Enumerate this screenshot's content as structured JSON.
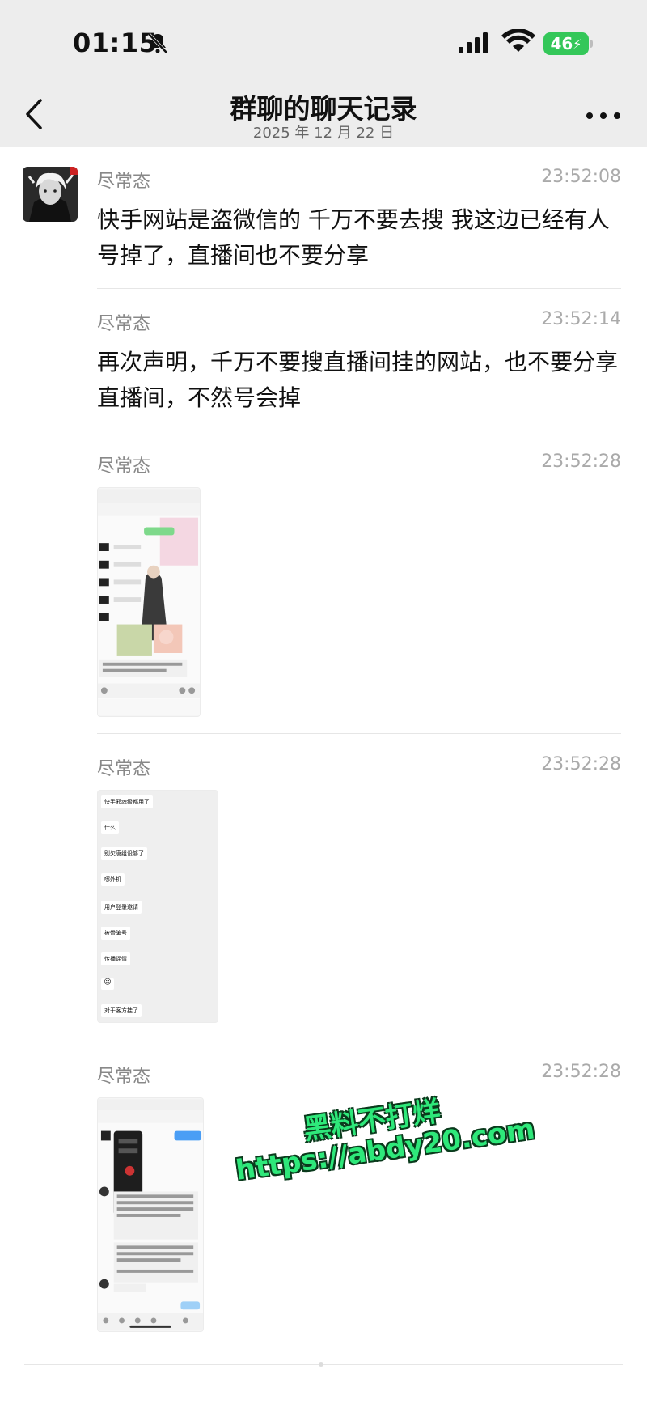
{
  "status_bar": {
    "time": "01:15",
    "battery_level": "46",
    "icons": [
      "bell-muted-icon",
      "cellular-signal-icon",
      "wifi-icon",
      "battery-charging-icon"
    ]
  },
  "nav": {
    "title": "群聊的聊天记录",
    "subtitle": "2025 年 12 月 22 日",
    "icons": [
      "back-chevron-icon",
      "more-dots-icon"
    ]
  },
  "messages": [
    {
      "sender": "尽常态",
      "time": "23:52:08",
      "text": "快手网站是盗微信的 千万不要去搜 我这边已经有人号掉了，直播间也不要分享"
    },
    {
      "sender": "尽常态",
      "time": "23:52:14",
      "text": "再次声明，千万不要搜直播间挂的网站，也不要分享直播间，不然号会掉"
    },
    {
      "sender": "尽常态",
      "time": "23:52:28",
      "image": "screenshot-thumbnail"
    },
    {
      "sender": "尽常态",
      "time": "23:52:28",
      "image": "screenshot-thumbnail",
      "bubbles": [
        "快手邪魂级都用了",
        "什么",
        "别欠唐组设够了",
        "哪外机",
        "用户登录邀请",
        "被骨骗号",
        "传播谣情",
        "对于客方挂了"
      ]
    },
    {
      "sender": "尽常态",
      "time": "23:52:28",
      "image": "screenshot-thumbnail"
    }
  ],
  "watermark": {
    "line1": "黑料不打烊",
    "line2": "https://abdy20.com"
  },
  "colors": {
    "header_bg": "#ededed",
    "battery": "#34c759",
    "watermark": "#2ee87a"
  }
}
